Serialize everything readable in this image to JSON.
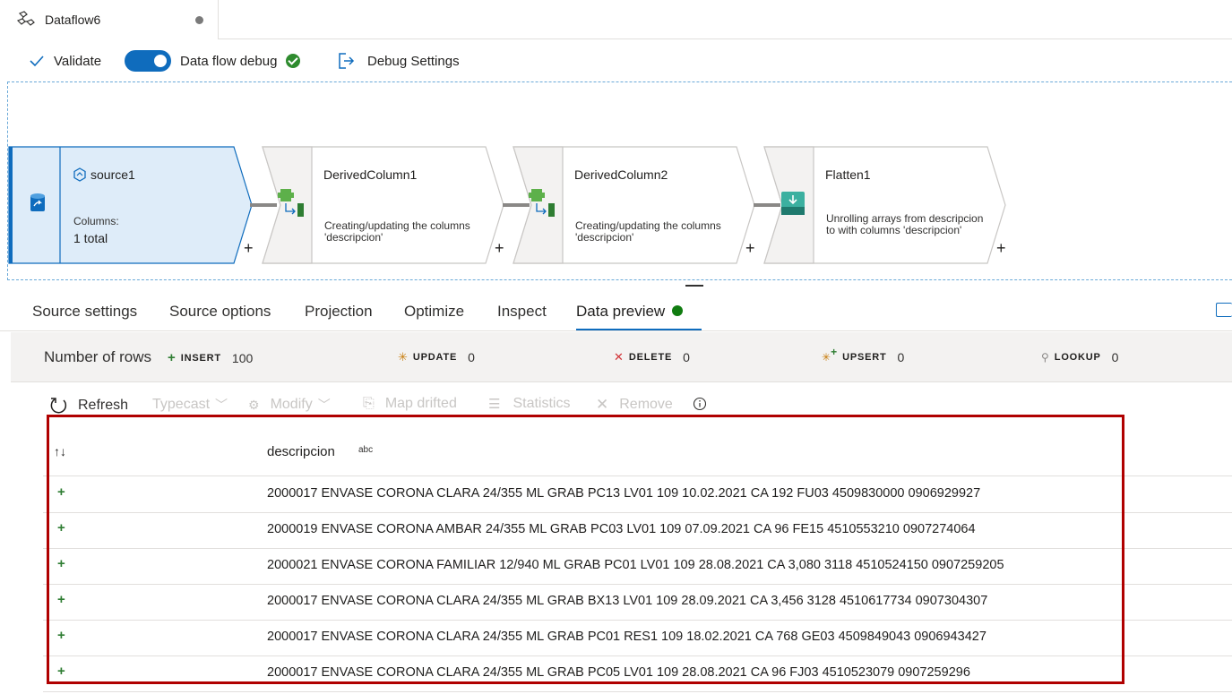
{
  "tab": {
    "title": "Dataflow6",
    "icon": "dataflow-icon"
  },
  "toolbar": {
    "validate_label": "Validate",
    "debug_label": "Data flow debug",
    "debug_settings_label": "Debug Settings"
  },
  "nodes": [
    {
      "title": "source1",
      "columns_label": "Columns:",
      "columns_value": "1 total"
    },
    {
      "title": "DerivedColumn1",
      "desc": "Creating/updating the columns 'descripcion'"
    },
    {
      "title": "DerivedColumn2",
      "desc": "Creating/updating the columns 'descripcion'"
    },
    {
      "title": "Flatten1",
      "desc": "Unrolling arrays from descripcion to  with columns 'descripcion'"
    }
  ],
  "plus_symbol": "+",
  "panel_tabs": [
    "Source settings",
    "Source options",
    "Projection",
    "Optimize",
    "Inspect",
    "Data preview"
  ],
  "stats": {
    "title": "Number of rows",
    "insert_label": "INSERT",
    "insert_value": "100",
    "update_label": "UPDATE",
    "update_value": "0",
    "delete_label": "DELETE",
    "delete_value": "0",
    "upsert_label": "UPSERT",
    "upsert_value": "0",
    "lookup_label": "LOOKUP",
    "lookup_value": "0"
  },
  "preview_toolbar": {
    "refresh": "Refresh",
    "typecast": "Typecast",
    "modify": "Modify",
    "map_drifted": "Map drifted",
    "statistics": "Statistics",
    "remove": "Remove"
  },
  "table": {
    "sort_symbol": "↑↓",
    "column": "descripcion",
    "column_type": "abc",
    "row_marker": "+",
    "rows": [
      "2000017 ENVASE CORONA CLARA 24/355 ML GRAB PC13 LV01 109 10.02.2021 CA 192 FU03 4509830000 0906929927",
      "2000019 ENVASE CORONA AMBAR 24/355 ML GRAB PC03 LV01 109 07.09.2021 CA 96 FE15 4510553210 0907274064",
      "2000021 ENVASE CORONA FAMILIAR 12/940 ML GRAB PC01 LV01 109 28.08.2021 CA 3,080 3118 4510524150 0907259205",
      "2000017 ENVASE CORONA CLARA 24/355 ML GRAB BX13 LV01 109 28.09.2021 CA 3,456 3128 4510617734 0907304307",
      "2000017 ENVASE CORONA CLARA 24/355 ML GRAB PC01 RES1 109 18.02.2021 CA 768 GE03 4509849043 0906943427",
      "2000017 ENVASE CORONA CLARA 24/355 ML GRAB PC05 LV01 109 28.08.2021 CA 96 FJ03 4510523079 0907259296"
    ]
  },
  "colors": {
    "accent": "#0f6cbd",
    "success": "#107c10",
    "highlight_border": "#b00000",
    "source_bg": "#deecf9"
  }
}
